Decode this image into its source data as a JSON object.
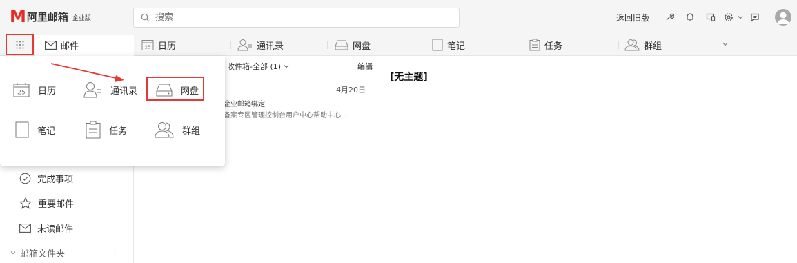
{
  "header": {
    "logo_mark": "M",
    "logo_text": "阿里邮箱",
    "logo_sub": "企业版",
    "search_placeholder": "搜索",
    "return_old": "返回旧版"
  },
  "nav": {
    "mail": "邮件",
    "items": [
      {
        "label": "日历",
        "icon": "calendar-icon"
      },
      {
        "label": "通讯录",
        "icon": "contacts-icon"
      },
      {
        "label": "网盘",
        "icon": "drive-icon"
      },
      {
        "label": "笔记",
        "icon": "notes-icon"
      },
      {
        "label": "任务",
        "icon": "tasks-icon"
      },
      {
        "label": "群组",
        "icon": "group-icon"
      }
    ]
  },
  "popup": {
    "calendar_day": "25",
    "apps": [
      {
        "label": "日历",
        "icon": "calendar-icon"
      },
      {
        "label": "通讯录",
        "icon": "contacts-icon"
      },
      {
        "label": "网盘",
        "icon": "drive-icon"
      },
      {
        "label": "笔记",
        "icon": "notes-icon"
      },
      {
        "label": "任务",
        "icon": "tasks-icon"
      },
      {
        "label": "群组",
        "icon": "group-icon"
      }
    ]
  },
  "sidebar": {
    "items": [
      {
        "label": "完成事项",
        "icon": "check-circle-icon"
      },
      {
        "label": "重要邮件",
        "icon": "star-icon"
      },
      {
        "label": "未读邮件",
        "icon": "envelope-icon"
      }
    ],
    "folders": "邮箱文件夹"
  },
  "list": {
    "filter": "收件箱-全部 (1)",
    "edit": "编辑",
    "message": {
      "date": "4月20日",
      "subject": "企业邮箱绑定",
      "preview": "备案专区管理控制台用户中心帮助中心..."
    }
  },
  "reading": {
    "title": "[无主题]"
  },
  "colors": {
    "brand": "#e52d27",
    "highlight": "#e53935"
  }
}
